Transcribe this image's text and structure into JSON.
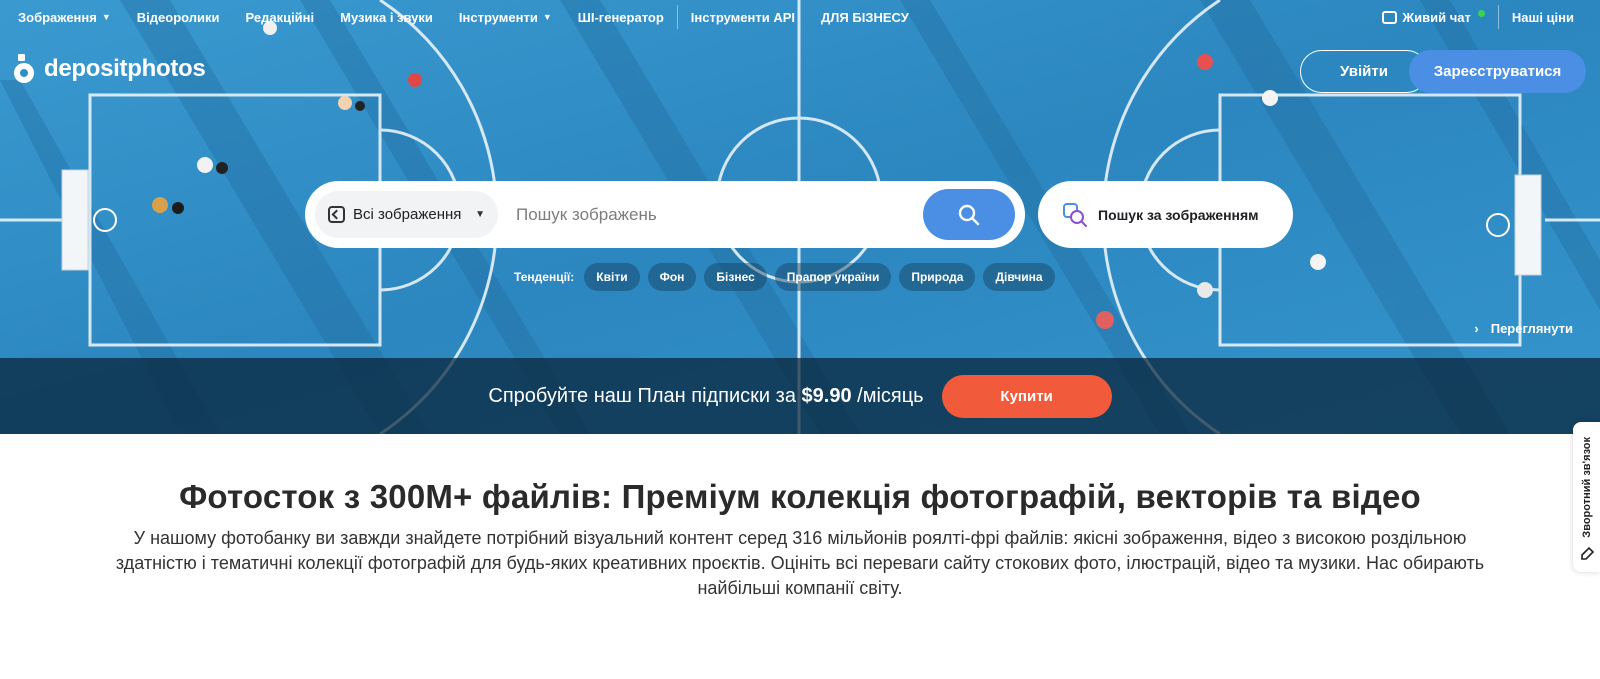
{
  "nav": {
    "items": [
      {
        "label": "Зображення",
        "has_caret": true
      },
      {
        "label": "Відеоролики",
        "has_caret": false
      },
      {
        "label": "Редакційні",
        "has_caret": false
      },
      {
        "label": "Музика і звуки",
        "has_caret": false
      },
      {
        "label": "Інструменти",
        "has_caret": true
      },
      {
        "label": "ШІ-генератор",
        "has_caret": false
      },
      {
        "label": "Інструменти API",
        "has_caret": false
      },
      {
        "label": "ДЛЯ БІЗНЕСУ",
        "has_caret": false
      }
    ],
    "live_chat": "Живий чат",
    "prices": "Наші ціни",
    "online_color": "#39d353"
  },
  "logo": {
    "text": "depositphotos"
  },
  "auth": {
    "login": "Увійти",
    "register": "Зареєструватися"
  },
  "search": {
    "type_selected": "Всі зображення",
    "placeholder": "Пошук зображень",
    "search_icon": "search-icon",
    "image_search_label": "Пошук за зображенням"
  },
  "trends": {
    "label": "Тенденції:",
    "chips": [
      "Квіти",
      "Фон",
      "Бізнес",
      "Прапор україни",
      "Природа",
      "Дівчина"
    ]
  },
  "view_link": "Переглянути",
  "promo": {
    "text_before": "Спробуйте наш План підписки за",
    "price": "$9.90",
    "text_after": "/місяць",
    "buy_button": "Купити",
    "buy_color": "#f25a3c"
  },
  "content": {
    "title": "Фотосток з 300M+ файлів: Преміум колекція фотографій, векторів та відео",
    "description": "У нашому фотобанку ви завжди знайдете потрібний візуальний контент серед 316 мільйонів роялті-фрі файлів: якісні зображення, відео з високою роздільною здатністю і тематичні колекції фотографій для будь-яких креативних проєктів. Оцініть всі переваги сайту стокових фото, ілюстрацій, відео та музики. Нас обирають найбільші компанії світу."
  },
  "feedback": {
    "label": "Зворотний зв'язок"
  },
  "colors": {
    "accent": "#4a8fe3",
    "court": "#2f8fc7"
  }
}
